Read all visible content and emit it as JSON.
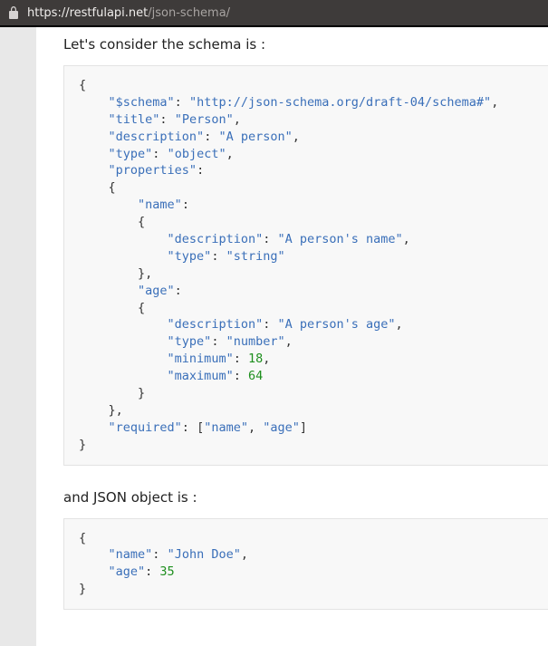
{
  "address_bar": {
    "host": "https://restfulapi.net",
    "path": "/json-schema/"
  },
  "content": {
    "intro_text": "Let's consider the schema is :",
    "mid_text": "and JSON object is :",
    "schema": {
      "$schema": "http://json-schema.org/draft-04/schema#",
      "title": "Person",
      "description": "A person",
      "type": "object",
      "properties": {
        "name": {
          "description": "A person's name",
          "type": "string"
        },
        "age": {
          "description": "A person's age",
          "type": "number",
          "minimum": 18,
          "maximum": 64
        }
      },
      "required": [
        "name",
        "age"
      ]
    },
    "object": {
      "name": "John Doe",
      "age": 35
    }
  }
}
